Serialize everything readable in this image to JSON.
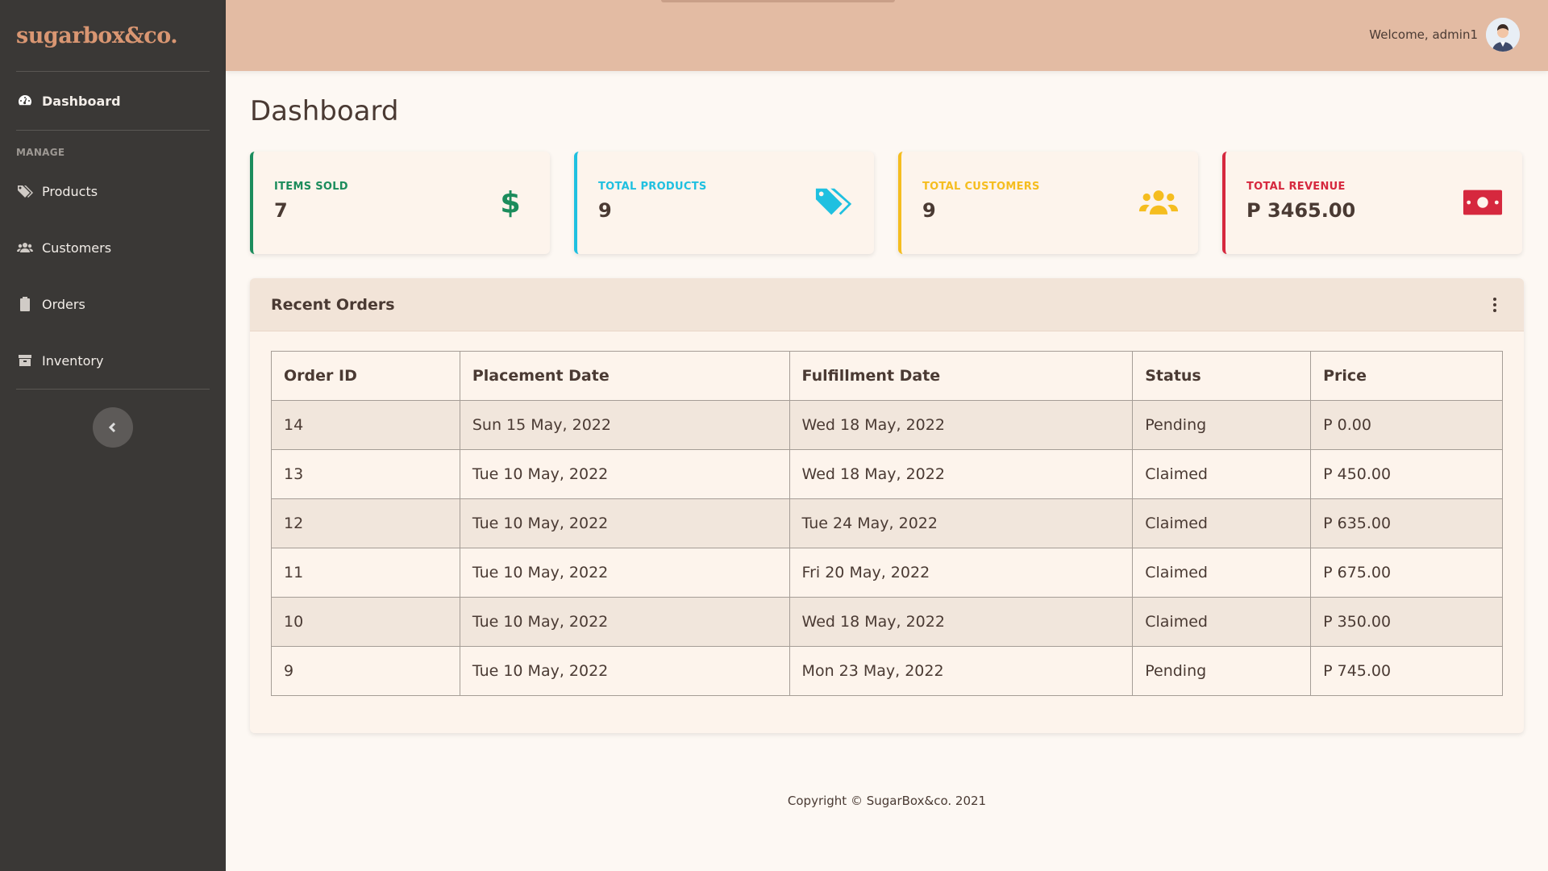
{
  "brand": {
    "name": "sugarbox&co."
  },
  "sidebar": {
    "dashboard_label": "Dashboard",
    "section_heading": "MANAGE",
    "items": [
      {
        "label": "Products",
        "icon": "tags-icon"
      },
      {
        "label": "Customers",
        "icon": "users-icon"
      },
      {
        "label": "Orders",
        "icon": "clipboard-icon"
      },
      {
        "label": "Inventory",
        "icon": "box-icon"
      }
    ]
  },
  "topbar": {
    "welcome": "Welcome, admin1"
  },
  "page": {
    "title": "Dashboard"
  },
  "cards": [
    {
      "label": "ITEMS SOLD",
      "value": "7",
      "color": "#1b8c5c",
      "icon": "dollar-icon"
    },
    {
      "label": "TOTAL PRODUCTS",
      "value": "9",
      "color": "#1fc0e0",
      "icon": "tags-icon"
    },
    {
      "label": "TOTAL CUSTOMERS",
      "value": "9",
      "color": "#f5bd1f",
      "icon": "users-icon"
    },
    {
      "label": "TOTAL REVENUE",
      "value": "P 3465.00",
      "color": "#d6283e",
      "icon": "money-bill-icon"
    }
  ],
  "orders": {
    "title": "Recent Orders",
    "columns": [
      "Order ID",
      "Placement Date",
      "Fulfillment Date",
      "Status",
      "Price"
    ],
    "rows": [
      [
        "14",
        "Sun 15 May, 2022",
        "Wed 18 May, 2022",
        "Pending",
        "P 0.00"
      ],
      [
        "13",
        "Tue 10 May, 2022",
        "Wed 18 May, 2022",
        "Claimed",
        "P 450.00"
      ],
      [
        "12",
        "Tue 10 May, 2022",
        "Tue 24 May, 2022",
        "Claimed",
        "P 635.00"
      ],
      [
        "11",
        "Tue 10 May, 2022",
        "Fri 20 May, 2022",
        "Claimed",
        "P 675.00"
      ],
      [
        "10",
        "Tue 10 May, 2022",
        "Wed 18 May, 2022",
        "Claimed",
        "P 350.00"
      ],
      [
        "9",
        "Tue 10 May, 2022",
        "Mon 23 May, 2022",
        "Pending",
        "P 745.00"
      ]
    ]
  },
  "footer": {
    "copyright": "Copyright © SugarBox&co. 2021"
  }
}
